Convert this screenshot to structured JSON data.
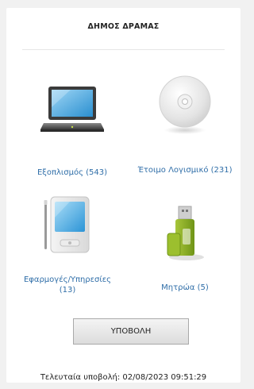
{
  "header": {
    "title": "ΔΗΜΟΣ ΔΡΑΜΑΣ"
  },
  "tiles": [
    {
      "label": "Εξοπλισμός (543)",
      "icon": "laptop-icon"
    },
    {
      "label": "Έτοιμο Λογισμικό (231)",
      "icon": "cd-icon"
    },
    {
      "label": "Εφαρμογές/Υπηρεσίες (13)",
      "icon": "tablet-icon"
    },
    {
      "label": "Μητρώα (5)",
      "icon": "usb-drive-icon"
    }
  ],
  "submit_button": {
    "label": "ΥΠΟΒΟΛΗ"
  },
  "footer": {
    "last_submission": "Τελευταία υποβολή: 02/08/2023 09:51:29"
  },
  "colors": {
    "link": "#2f6ea8",
    "background": "#f1f1f1",
    "panel": "#ffffff"
  }
}
